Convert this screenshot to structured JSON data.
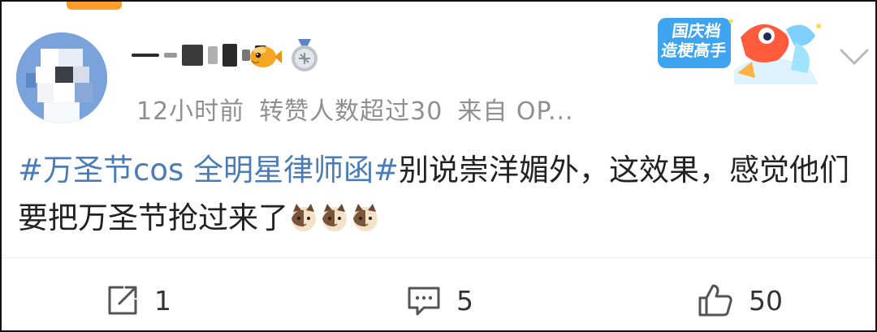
{
  "post": {
    "author_name_masked": true,
    "meta": {
      "time": "12小时前",
      "reposts": "转赞人数超过30",
      "source": "来自 OP..."
    },
    "promo_banner": {
      "line1": "国庆档",
      "line2": "造梗高手"
    },
    "text": {
      "hashtag": "#万圣节cos 全明星律师函#",
      "body": "别说崇洋媚外，这效果，感觉他们要把万圣节抢过来了"
    },
    "emoji_count": 3
  },
  "actions": {
    "share": {
      "icon": "share-icon",
      "count": "1"
    },
    "comment": {
      "icon": "comment-icon",
      "count": "5"
    },
    "like": {
      "icon": "thumbs-up-icon",
      "count": "50"
    }
  },
  "colors": {
    "hashtag": "#4a7db8",
    "meta_text": "#8f8f8f",
    "accent": "#ff9d2a"
  }
}
